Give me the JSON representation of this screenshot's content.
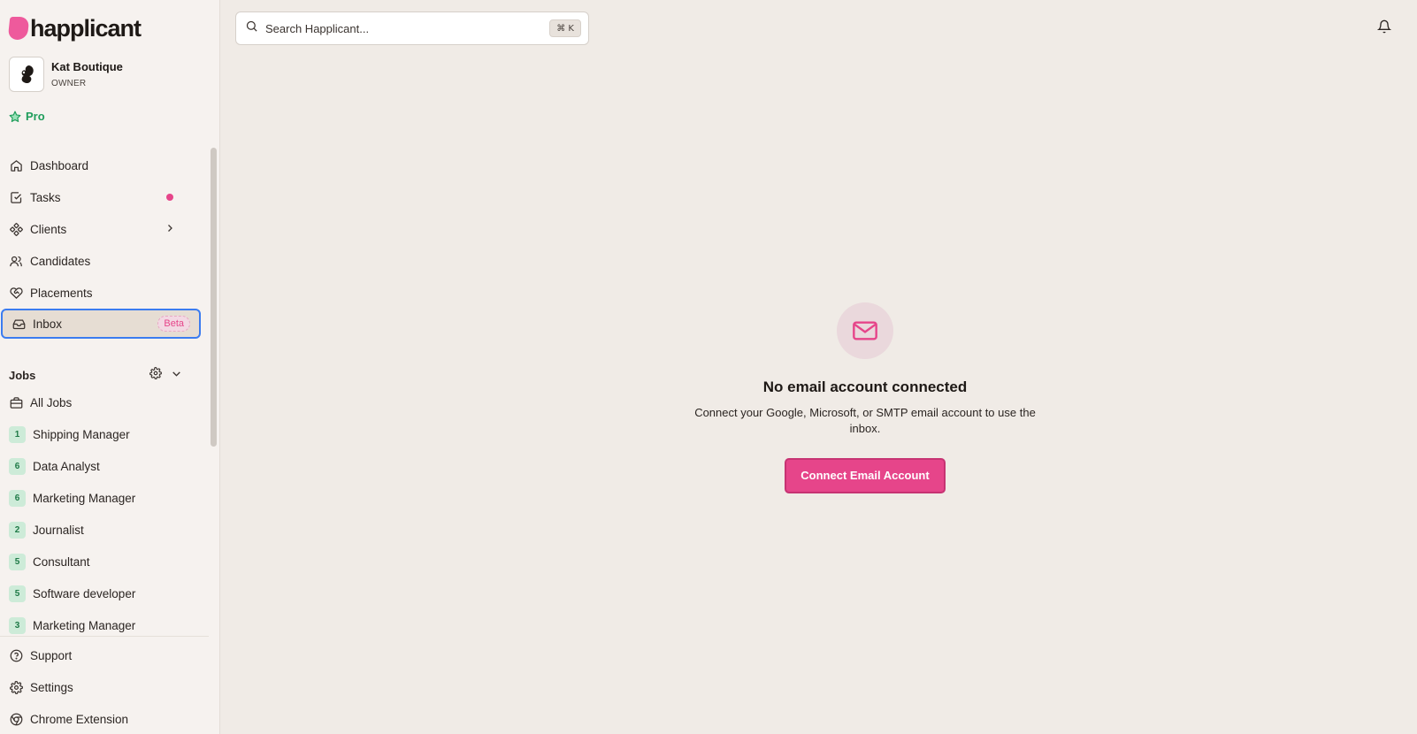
{
  "brand": {
    "name": "happlicant",
    "accent": "#e6458a"
  },
  "account": {
    "name": "Kat Boutique",
    "role": "OWNER"
  },
  "plan": {
    "label": "Pro",
    "color": "#1f9d5b"
  },
  "nav": [
    {
      "label": "Dashboard",
      "icon": "home-icon"
    },
    {
      "label": "Tasks",
      "icon": "checkbox-icon",
      "has_dot": true
    },
    {
      "label": "Clients",
      "icon": "clients-icon",
      "has_chevron": true
    },
    {
      "label": "Candidates",
      "icon": "users-icon"
    },
    {
      "label": "Placements",
      "icon": "heart-handshake-icon"
    },
    {
      "label": "Inbox",
      "icon": "inbox-icon",
      "badge": "Beta",
      "active": true
    }
  ],
  "jobs": {
    "title": "Jobs",
    "all_label": "All Jobs",
    "items": [
      {
        "count": "1",
        "label": "Shipping Manager"
      },
      {
        "count": "6",
        "label": "Data Analyst"
      },
      {
        "count": "6",
        "label": "Marketing Manager"
      },
      {
        "count": "2",
        "label": "Journalist"
      },
      {
        "count": "5",
        "label": "Consultant"
      },
      {
        "count": "5",
        "label": "Software developer"
      },
      {
        "count": "3",
        "label": "Marketing Manager"
      }
    ]
  },
  "bottom_nav": [
    {
      "label": "Support",
      "icon": "help-circle-icon"
    },
    {
      "label": "Settings",
      "icon": "gear-icon"
    },
    {
      "label": "Chrome Extension",
      "icon": "chrome-icon"
    }
  ],
  "search": {
    "placeholder": "Search Happlicant...",
    "shortcut": "⌘ K"
  },
  "empty_state": {
    "title": "No email account connected",
    "description": "Connect your Google, Microsoft, or SMTP email account to use the inbox.",
    "button": "Connect Email Account"
  }
}
